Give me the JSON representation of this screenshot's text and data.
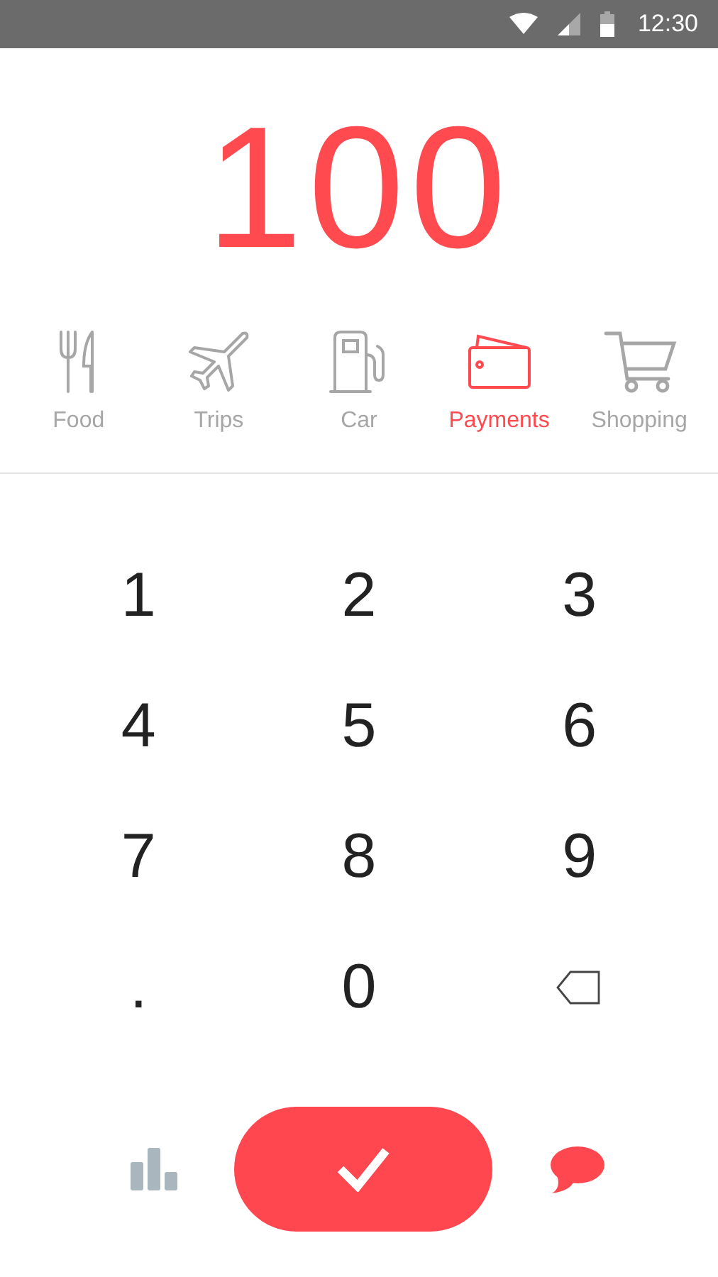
{
  "status_bar": {
    "time": "12:30"
  },
  "amount": "100",
  "categories": [
    {
      "kind": "food",
      "label": "Food",
      "selected": false
    },
    {
      "kind": "trips",
      "label": "Trips",
      "selected": false
    },
    {
      "kind": "car",
      "label": "Car",
      "selected": false
    },
    {
      "kind": "payments",
      "label": "Payments",
      "selected": true
    },
    {
      "kind": "shopping",
      "label": "Shopping",
      "selected": false
    }
  ],
  "keys": [
    {
      "kind": "digit",
      "label": "1"
    },
    {
      "kind": "digit",
      "label": "2"
    },
    {
      "kind": "digit",
      "label": "3"
    },
    {
      "kind": "digit",
      "label": "4"
    },
    {
      "kind": "digit",
      "label": "5"
    },
    {
      "kind": "digit",
      "label": "6"
    },
    {
      "kind": "digit",
      "label": "7"
    },
    {
      "kind": "digit",
      "label": "8"
    },
    {
      "kind": "digit",
      "label": "9"
    },
    {
      "kind": "decimal",
      "label": "."
    },
    {
      "kind": "digit",
      "label": "0"
    },
    {
      "kind": "backspace"
    }
  ]
}
